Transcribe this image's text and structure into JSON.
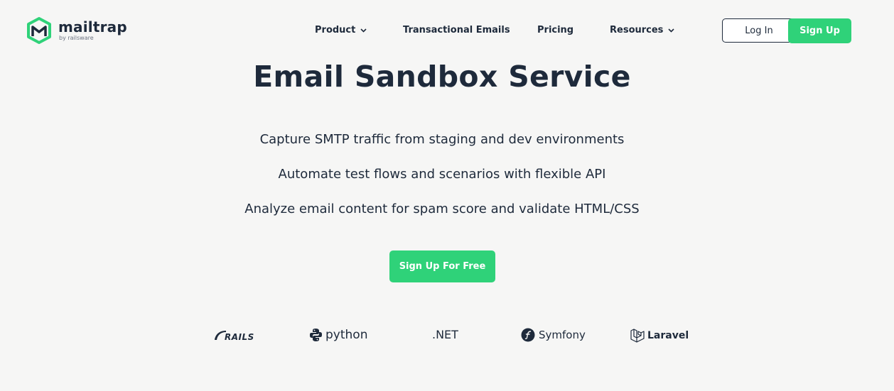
{
  "brand": {
    "name": "mailtrap",
    "tagline": "by railsware",
    "primary_color": "#2fd279",
    "text_color": "#1e2a3b",
    "logo_icon": "mailtrap-logo-icon"
  },
  "nav": {
    "items": [
      {
        "label": "Product",
        "has_dropdown": true
      },
      {
        "label": "Transactional Emails",
        "has_dropdown": false
      },
      {
        "label": "Pricing",
        "has_dropdown": false
      },
      {
        "label": "Resources",
        "has_dropdown": true
      }
    ],
    "login_label": "Log In",
    "signup_label": "Sign Up"
  },
  "hero": {
    "title": "Email Sandbox Service",
    "features": [
      "Capture SMTP traffic from staging and dev environments",
      "Automate test flows and scenarios with flexible API",
      "Analyze email content for spam score and validate HTML/CSS"
    ],
    "cta_label": "Sign Up For Free"
  },
  "frameworks": [
    {
      "label": "RAILS",
      "icon": "rails-icon"
    },
    {
      "label": "python",
      "icon": "python-icon"
    },
    {
      "label": ".NET",
      "icon": ""
    },
    {
      "label": "Symfony",
      "icon": "symfony-icon"
    },
    {
      "label": "Laravel",
      "icon": "laravel-icon"
    }
  ]
}
